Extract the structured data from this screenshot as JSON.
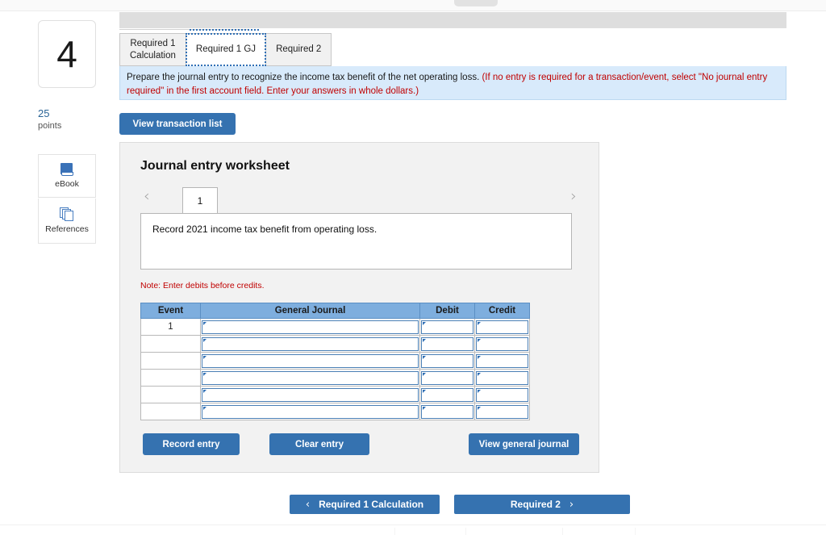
{
  "question": {
    "number": "4",
    "points_value": "25",
    "points_label": "points"
  },
  "rail": {
    "ebook_label": "eBook",
    "references_label": "References",
    "ebook_icon": "book-icon",
    "references_icon": "documents-stack-icon"
  },
  "tabs": [
    {
      "label": "Required 1\nCalculation",
      "active": false
    },
    {
      "label": "Required 1 GJ",
      "active": true
    },
    {
      "label": "Required 2",
      "active": false
    }
  ],
  "instruction": {
    "black_text": "Prepare the journal entry to recognize the income tax benefit of the net operating loss.",
    "red_text": "(If no entry is required for a transaction/event, select \"No journal entry required\" in the first account field. Enter your answers in whole dollars.)"
  },
  "toolbar": {
    "view_transaction_list_label": "View transaction list"
  },
  "worksheet": {
    "title": "Journal entry worksheet",
    "pager": {
      "prev_icon": "chevron-left-icon",
      "next_icon": "chevron-right-icon",
      "current_page": "1"
    },
    "description": "Record 2021 income tax benefit from operating loss.",
    "note": "Note: Enter debits before credits.",
    "table": {
      "columns": [
        "Event",
        "General Journal",
        "Debit",
        "Credit"
      ],
      "rows": [
        {
          "event": "1",
          "general_journal": "",
          "debit": "",
          "credit": ""
        },
        {
          "event": "",
          "general_journal": "",
          "debit": "",
          "credit": ""
        },
        {
          "event": "",
          "general_journal": "",
          "debit": "",
          "credit": ""
        },
        {
          "event": "",
          "general_journal": "",
          "debit": "",
          "credit": ""
        },
        {
          "event": "",
          "general_journal": "",
          "debit": "",
          "credit": ""
        },
        {
          "event": "",
          "general_journal": "",
          "debit": "",
          "credit": ""
        }
      ]
    },
    "actions": {
      "record_entry_label": "Record entry",
      "clear_entry_label": "Clear entry",
      "view_general_journal_label": "View general journal"
    }
  },
  "footer_nav": {
    "prev_label": "Required 1 Calculation",
    "prev_icon": "chevron-left-icon",
    "next_label": "Required 2",
    "next_icon": "chevron-right-icon"
  },
  "colors": {
    "accent_blue": "#3572b0",
    "table_header_blue": "#7eaede",
    "instruction_band": "#d8eafb",
    "alert_red": "#c00000",
    "panel_gray": "#f2f2f2"
  }
}
